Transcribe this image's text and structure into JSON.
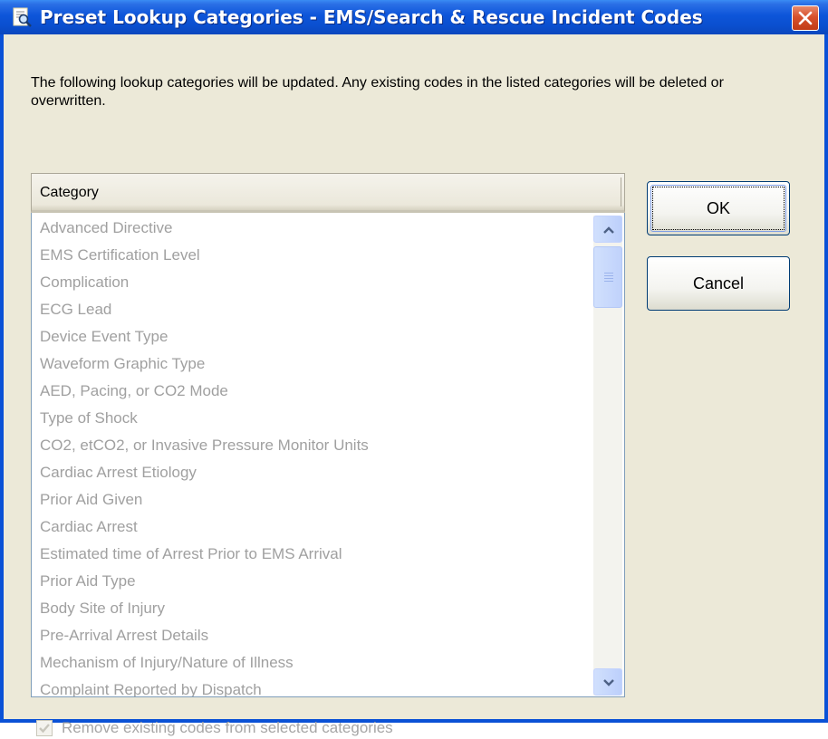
{
  "window": {
    "title": "Preset Lookup Categories - EMS/Search & Rescue Incident Codes",
    "icon": "lookup-window-icon",
    "close_icon": "close-icon"
  },
  "description": "The following lookup categories will be updated. Any existing codes in the listed categories will be deleted or overwritten.",
  "list": {
    "column_header": "Category",
    "items": [
      "Advanced Directive",
      "EMS Certification Level",
      "Complication",
      "ECG Lead",
      "Device Event Type",
      "Waveform Graphic Type",
      "AED, Pacing, or CO2 Mode",
      "Type of Shock",
      "CO2, etCO2, or Invasive Pressure Monitor Units",
      "Cardiac Arrest Etiology",
      "Prior Aid Given",
      "Cardiac Arrest",
      "Estimated time of Arrest Prior to EMS Arrival",
      "Prior Aid Type",
      "Body Site of Injury",
      "Pre-Arrival Arrest Details",
      "Mechanism of Injury/Nature of Illness",
      "Complaint Reported by Dispatch"
    ],
    "scroll_up_icon": "chevron-up-icon",
    "scroll_down_icon": "chevron-down-icon"
  },
  "buttons": {
    "ok_label": "OK",
    "cancel_label": "Cancel"
  },
  "option": {
    "label": "Remove existing codes from selected categories",
    "checked": true,
    "disabled": true
  },
  "colors": {
    "title_bar": "#0a51d6",
    "dialog_bg": "#ece9d8",
    "disabled_text": "#a0a0a0"
  }
}
